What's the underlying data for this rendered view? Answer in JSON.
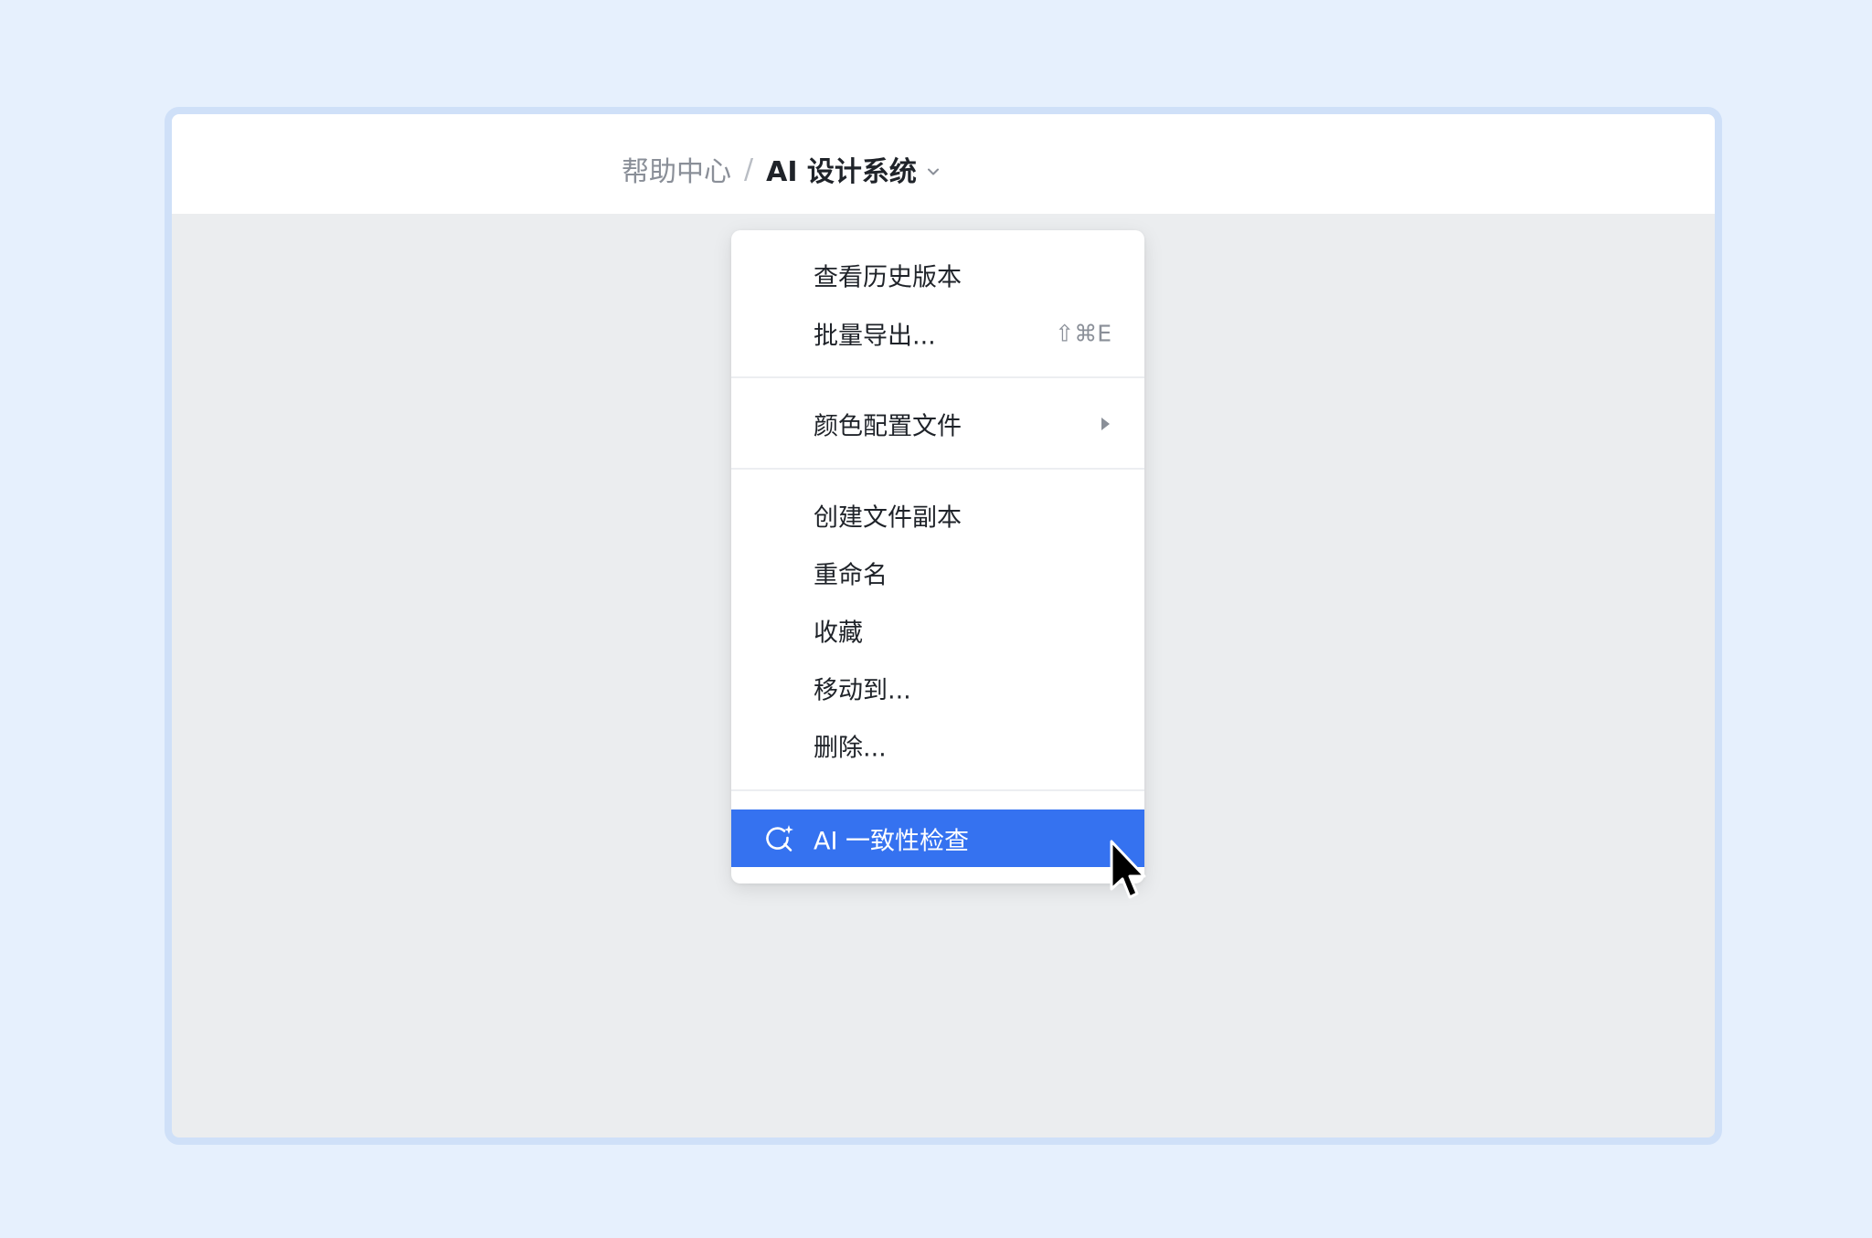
{
  "breadcrumb": {
    "parent": "帮助中心",
    "separator": "/",
    "current": "AI 设计系统"
  },
  "menu": {
    "items": [
      {
        "label": "查看历史版本"
      },
      {
        "label": "批量导出...",
        "shortcut": "⇧⌘E"
      },
      {
        "label": "颜色配置文件"
      },
      {
        "label": "创建文件副本"
      },
      {
        "label": "重命名"
      },
      {
        "label": "收藏"
      },
      {
        "label": "移动到..."
      },
      {
        "label": "删除..."
      },
      {
        "label": "AI 一致性检查"
      }
    ]
  },
  "colors": {
    "highlight": "#3572f0",
    "page_background": "#e6f0fd",
    "window_border": "#cfe0f8"
  },
  "icons": {
    "chevron": "chevron-down-icon",
    "submenu": "chevron-right-icon",
    "ai": "ai-sparkle-search-icon",
    "cursor": "mouse-pointer-icon"
  }
}
